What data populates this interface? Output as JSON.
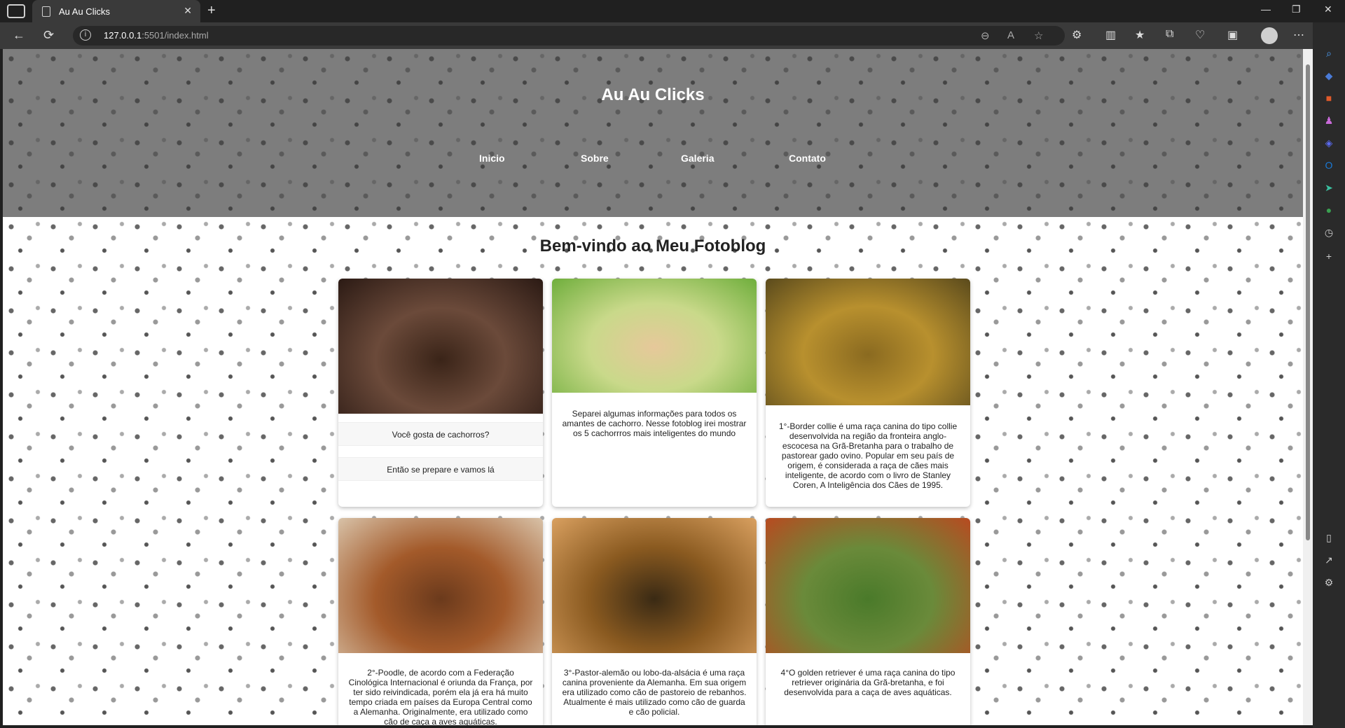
{
  "browser": {
    "tab_title": "Au Au Clicks",
    "close_glyph": "✕",
    "new_tab_glyph": "+",
    "url_host": "127.0.0.1",
    "url_rest": ":5501/index.html",
    "window_min": "—",
    "window_restore": "❐",
    "window_close": "✕"
  },
  "site": {
    "title": "Au Au Clicks",
    "nav": [
      "Inicio",
      "Sobre",
      "Galeria",
      "Contato"
    ],
    "welcome": "Bem-vindo ao Meu Fotoblog"
  },
  "cards": [
    {
      "caption": "Você gosta de cachorros?",
      "caption2": "Então se prepare e vamos lá",
      "photo_colors": [
        "#2b1a14",
        "#6b4a3a",
        "#3a2418"
      ]
    },
    {
      "caption": "Separei algumas informações para todos os amantes de cachorro. Nesse fotoblog irei mostrar os 5 cachorrros mais inteligentes do mundo",
      "photo_colors": [
        "#6fae3c",
        "#c9d98a",
        "#e6c89a"
      ]
    },
    {
      "caption": "1°-Border collie é uma raça canina do tipo collie desenvolvida na região da fronteira anglo-escocesa na Grã-Bretanha para o trabalho de pastorear gado ovino. Popular em seu país de origem, é considerada a raça de cães mais inteligente, de acordo com o livro de Stanley Coren, A Inteligência dos Cães de 1995.",
      "photo_colors": [
        "#5a4a1c",
        "#b8902e",
        "#8a6a20"
      ]
    },
    {
      "caption": "2°-Poodle, de acordo com a Federação Cinológica Internacional é oriunda da França, por ter sido reivindicada, porém ela já era há muito tempo criada em países da Europa Central como a Alemanha. Originalmente, era utilizado como cão de caça a aves aquáticas.",
      "photo_colors": [
        "#d8c2a8",
        "#a35a2a",
        "#6b3a1c"
      ]
    },
    {
      "caption": "3°-Pastor-alemão ou lobo-da-alsácia é uma raça canina proveniente da Alemanha. Em sua origem era utilizado como cão de pastoreio de rebanhos. Atualmente é mais utilizado como cão de guarda e cão policial.",
      "photo_colors": [
        "#d9a060",
        "#8a5a20",
        "#3a2a14"
      ]
    },
    {
      "caption": "4°O golden retriever é uma raça canina do tipo retriever originária da Grã-bretanha, e foi desenvolvida para a caça de aves aquáticas.",
      "photo_colors": [
        "#b84a20",
        "#6a8a3a",
        "#4a7a2a"
      ]
    }
  ],
  "icons": {
    "tab_actions": "tab-actions-icon",
    "back": "←",
    "reload": "⟳",
    "info": "i",
    "zoom": "⊖",
    "read_aloud": "A",
    "favorite": "☆",
    "extensions": "⚙",
    "split": "▥",
    "favorites": "★",
    "collections": "⧉",
    "browser_essentials": "♡",
    "screenshot": "▣",
    "more": "⋯",
    "copilot": "b"
  },
  "sidebar": [
    {
      "name": "search",
      "glyph": "⌕",
      "color": "#4da3ff"
    },
    {
      "name": "tag",
      "glyph": "◆",
      "color": "#4a7bd8"
    },
    {
      "name": "toolbox",
      "glyph": "■",
      "color": "#e05a2a"
    },
    {
      "name": "games",
      "glyph": "♟",
      "color": "#c86ad8"
    },
    {
      "name": "copilot-apps",
      "glyph": "◈",
      "color": "#5a6af0"
    },
    {
      "name": "outlook",
      "glyph": "O",
      "color": "#1a7ad8"
    },
    {
      "name": "send",
      "glyph": "➤",
      "color": "#3ac0a0"
    },
    {
      "name": "tree",
      "glyph": "●",
      "color": "#3aa050"
    },
    {
      "name": "clock",
      "glyph": "◷",
      "color": "#cccccc"
    },
    {
      "name": "add",
      "glyph": "+",
      "color": "#cccccc"
    },
    {
      "name": "sidebar-toggle",
      "glyph": "▯",
      "color": "#cccccc"
    },
    {
      "name": "open-external",
      "glyph": "↗",
      "color": "#cccccc"
    },
    {
      "name": "settings",
      "glyph": "⚙",
      "color": "#cccccc"
    }
  ]
}
